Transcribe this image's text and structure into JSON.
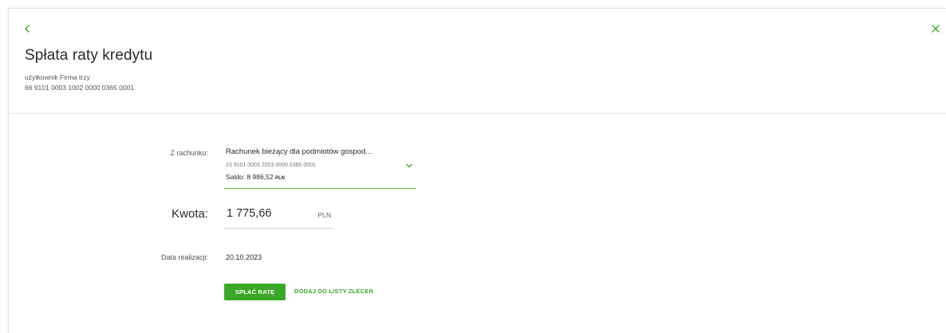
{
  "colors": {
    "accent": "#3aa826",
    "underline_active": "#5db22b",
    "divider": "#e6e6e6"
  },
  "header": {
    "back_icon": "chevron-left-icon",
    "close_icon": "close-icon",
    "title": "Spłata raty kredytu",
    "owner": "użytkownik Firma trzy",
    "account_number": "66 9101 0003 1002 0000 0365 0001"
  },
  "form": {
    "from_label": "Z rachunku:",
    "from_account": {
      "name": "Rachunek bieżący dla podmiotów gospod...",
      "number": "23 9101 0003 2003 0000 0365 0001",
      "balance_label": "Saldo: 8 986,52",
      "balance_currency": "PLN",
      "chevron_icon": "chevron-down-icon"
    },
    "amount_label": "Kwota:",
    "amount_value": "1 775,66",
    "amount_currency": "PLN",
    "date_label": "Data realizacji:",
    "date_value": "20.10.2023"
  },
  "actions": {
    "primary_label": "SPŁAĆ RATĘ",
    "secondary_label": "DODAJ DO LISTY ZLECEŃ"
  }
}
